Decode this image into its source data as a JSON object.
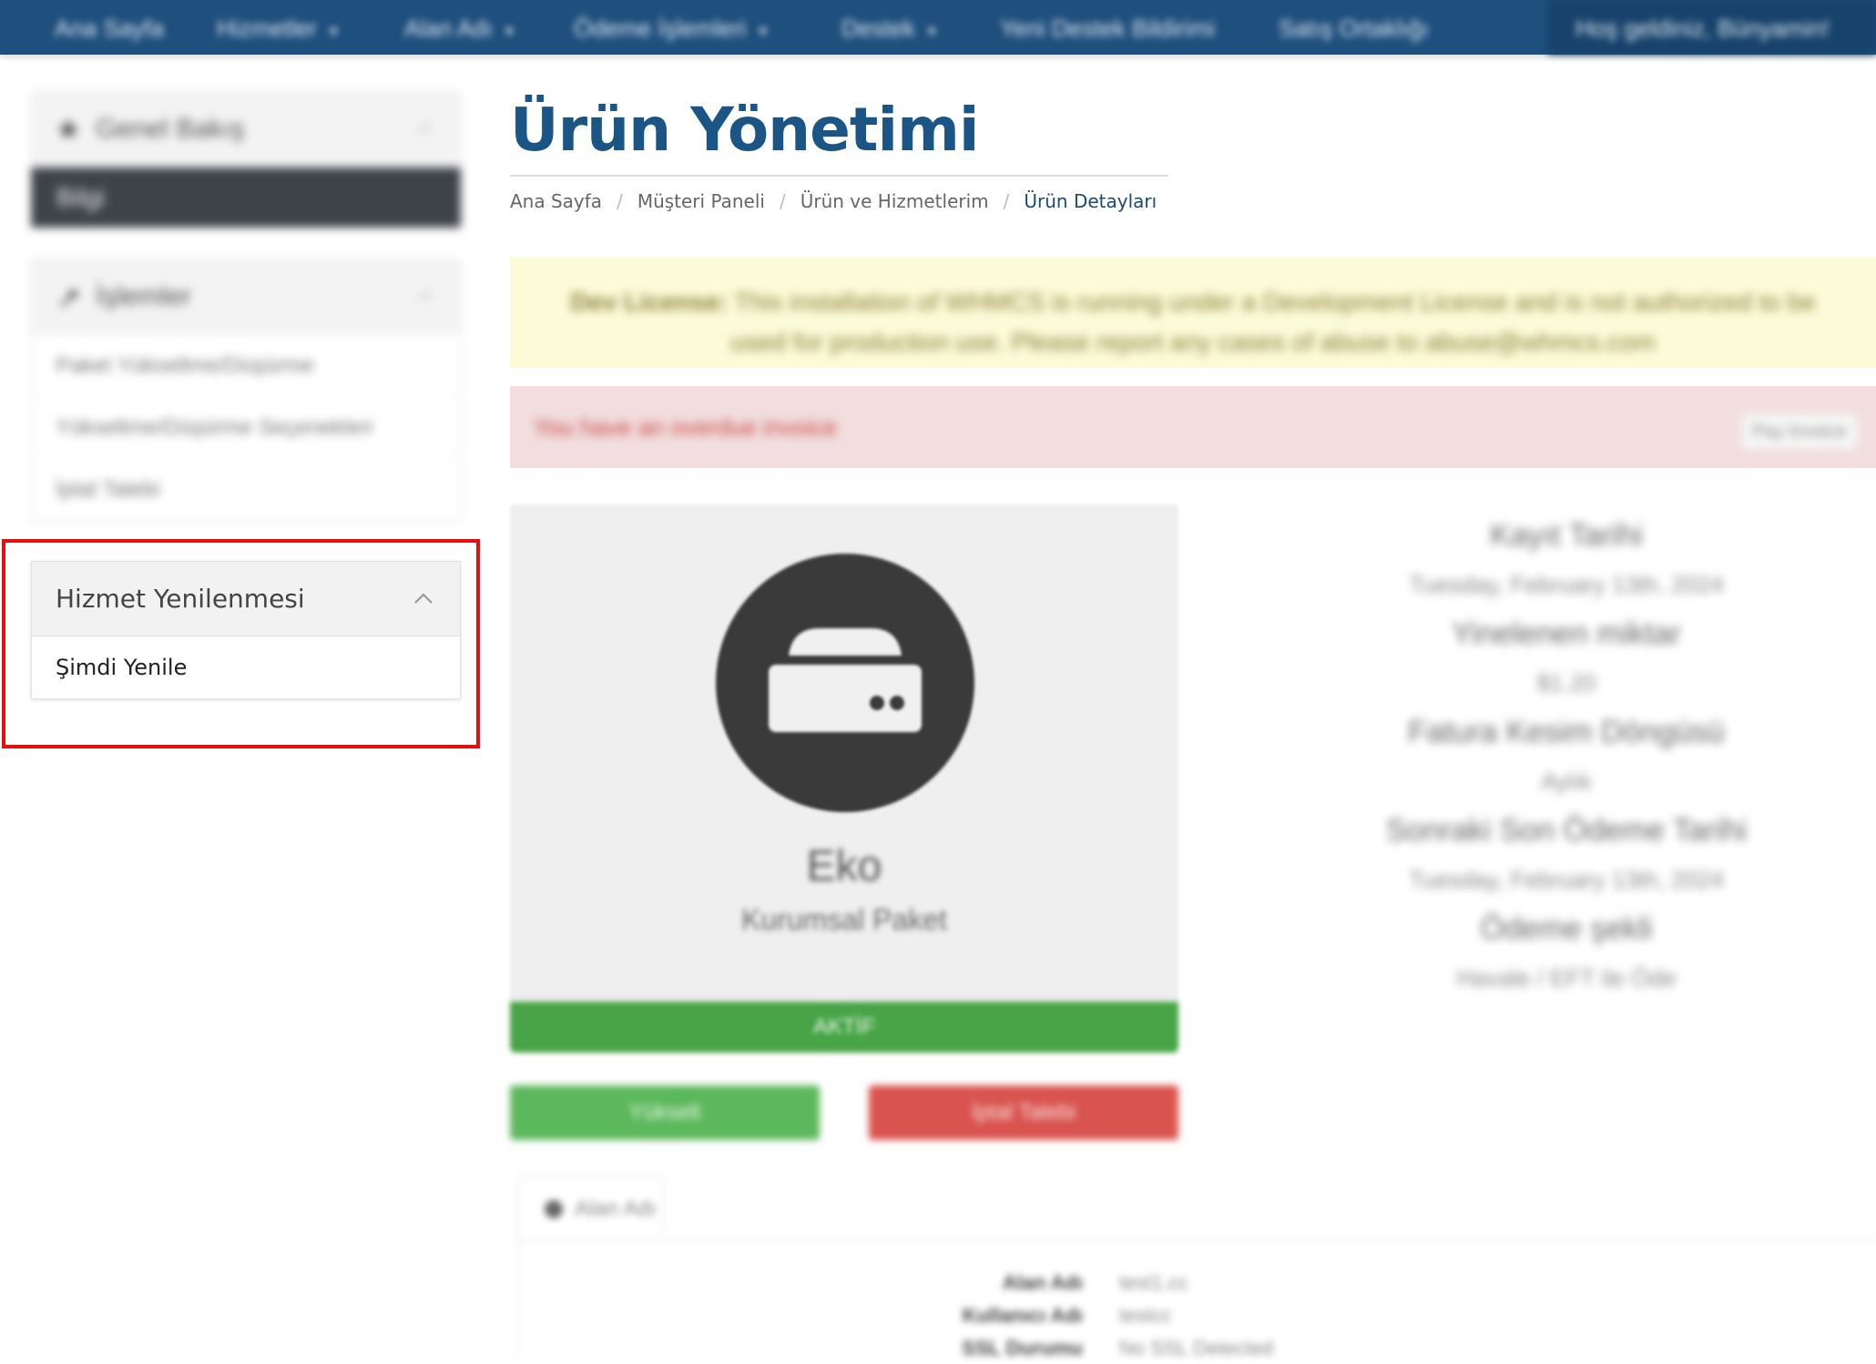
{
  "topnav": {
    "items": [
      {
        "label": "Ana Sayfa",
        "dropdown": false
      },
      {
        "label": "Hizmetler",
        "dropdown": true
      },
      {
        "label": "Alan Adı",
        "dropdown": true
      },
      {
        "label": "Ödeme İşlemleri",
        "dropdown": true
      },
      {
        "label": "Destek",
        "dropdown": true
      },
      {
        "label": "Yeni Destek Bildirimi",
        "dropdown": false
      },
      {
        "label": "Satış Ortaklığı",
        "dropdown": false
      }
    ],
    "greeting": "Hoş geldiniz, Bünyamin!"
  },
  "sidebar": {
    "overview": {
      "title": "Genel Bakış",
      "active_item": "Bilgi"
    },
    "actions": {
      "title": "İşlemler",
      "items": [
        "Paket Yükseltme/Düşürme",
        "Yükseltme/Düşürme Seçenekleri",
        "İptal Talebi"
      ]
    },
    "renewal": {
      "title": "Hizmet Yenilenmesi",
      "item": "Şimdi Yenile"
    }
  },
  "page": {
    "title": "Ürün Yönetimi",
    "breadcrumb": [
      "Ana Sayfa",
      "Müşteri Paneli",
      "Ürün ve Hizmetlerim",
      "Ürün Detayları"
    ]
  },
  "alerts": {
    "dev_license_bold": "Dev License:",
    "dev_license_text": "This installation of WHMCS is running under a Development License and is not authorized to be used for production use. Please report any cases of abuse to abuse@whmcs.com",
    "unpaid_text": "You have an overdue invoice",
    "unpaid_button": "Pay Invoice"
  },
  "product": {
    "name": "Eko",
    "group": "Kurumsal Paket",
    "status": "AKTİF",
    "upgrade_button": "Yükselt",
    "cancel_button": "İptal Talebi"
  },
  "info": [
    {
      "label": "Kayıt Tarihi",
      "value": "Tuesday, February 13th, 2024"
    },
    {
      "label": "Yinelenen miktar",
      "value": "$1.20"
    },
    {
      "label": "Fatura Kesim Döngüsü",
      "value": "Aylık"
    },
    {
      "label": "Sonraki Son Ödeme Tarihi",
      "value": "Tuesday, February 13th, 2024"
    },
    {
      "label": "Ödeme şekli",
      "value": "Havale / EFT ile Öde"
    }
  ],
  "tabs": {
    "domain_tab": "Alan Adı",
    "rows": [
      {
        "key": "Alan Adı",
        "value": "test1.cc"
      },
      {
        "key": "Kullanıcı Adı",
        "value": "testcc"
      },
      {
        "key": "SSL Durumu",
        "value": "No SSL Detected"
      }
    ]
  },
  "colors": {
    "navbar": "#1f4f7d",
    "title": "#1b5585",
    "highlight": "#e50f0f",
    "status_green": "#47a447",
    "upgrade_green": "#5cb85c",
    "cancel_red": "#d9534f"
  }
}
